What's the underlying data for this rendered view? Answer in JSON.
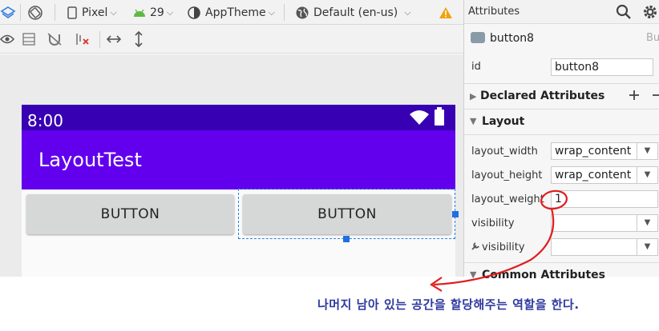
{
  "toolbar": {
    "device": "Pixel",
    "api_level": "29",
    "theme": "AppTheme",
    "locale": "Default (en-us)"
  },
  "device_preview": {
    "status_time": "8:00",
    "app_title": "LayoutTest",
    "button_left_label": "BUTTON",
    "button_right_label": "BUTTON"
  },
  "attributes": {
    "panel_title": "Attributes",
    "component_name": "button8",
    "component_type_hint": "Bu",
    "id_label": "id",
    "id_value": "button8",
    "declared_section": "Declared Attributes",
    "layout_section": "Layout",
    "rows": {
      "layout_width_label": "layout_width",
      "layout_width_value": "wrap_content",
      "layout_height_label": "layout_height",
      "layout_height_value": "wrap_content",
      "layout_weight_label": "layout_weight",
      "layout_weight_value": "1",
      "visibility_label": "visibility",
      "tools_visibility_label": "visibility"
    },
    "common_section": "Common Attributes"
  },
  "annotation": {
    "text": "나머지 남아 있는 공간을 할당해주는 역할을 한다.",
    "color": "#e11d1d"
  },
  "colors": {
    "status_bar": "#3700b3",
    "app_bar": "#6200ee",
    "selection": "#2f7de1"
  }
}
